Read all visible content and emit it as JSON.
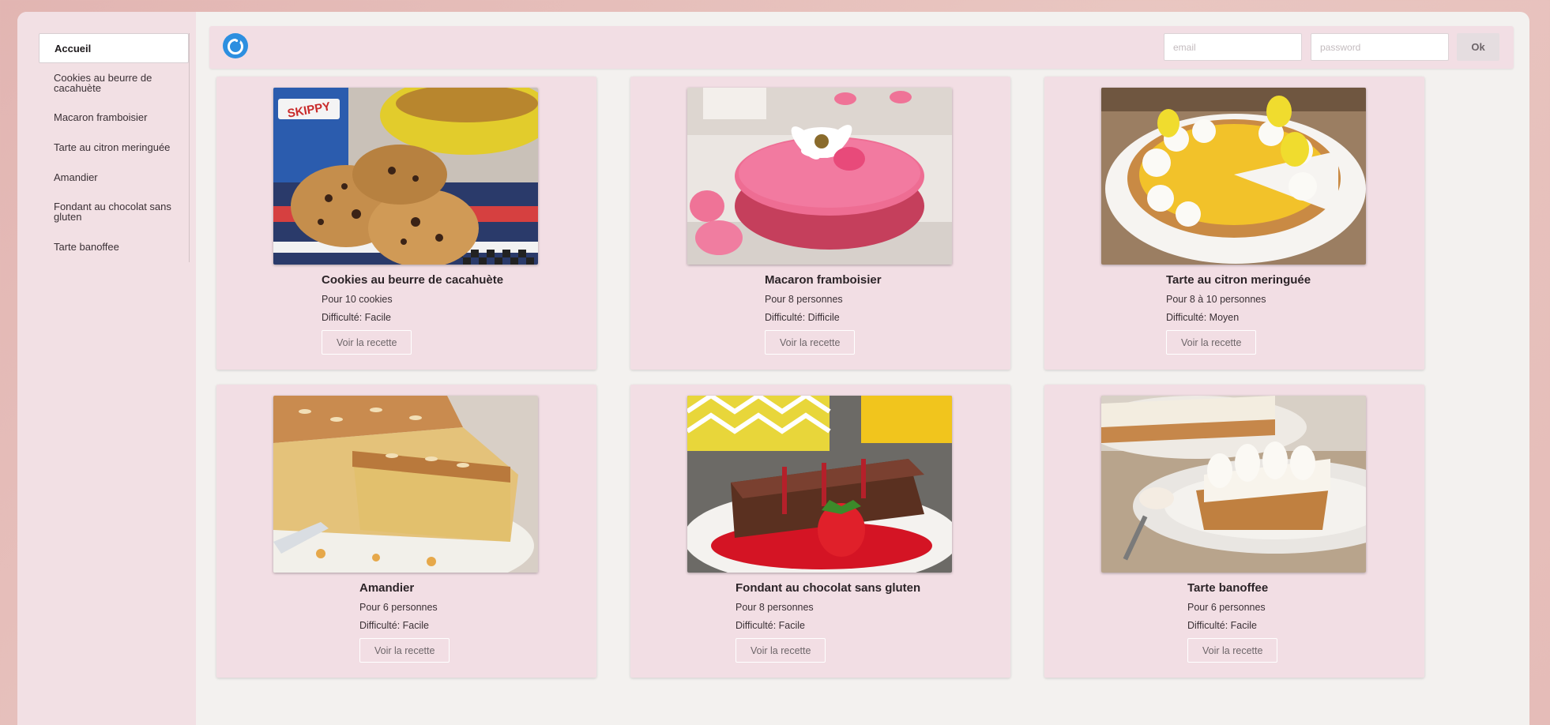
{
  "sidebar": {
    "items": [
      {
        "label": "Accueil"
      },
      {
        "label": "Cookies au beurre de cacahuète"
      },
      {
        "label": "Macaron framboisier"
      },
      {
        "label": "Tarte au citron meringuée"
      },
      {
        "label": "Amandier"
      },
      {
        "label": "Fondant au chocolat sans gluten"
      },
      {
        "label": "Tarte banoffee"
      }
    ]
  },
  "header": {
    "email_placeholder": "email",
    "password_placeholder": "password",
    "ok_label": "Ok"
  },
  "cards": [
    {
      "title": "Cookies au beurre de cacahuète",
      "servings": "Pour 10 cookies",
      "difficulty": "Difficulté: Facile",
      "button": "Voir la recette",
      "image": "cookies-photo",
      "image_text": "SKIPPY"
    },
    {
      "title": "Macaron framboisier",
      "servings": "Pour 8 personnes",
      "difficulty": "Difficulté: Difficile",
      "button": "Voir la recette",
      "image": "macaron-photo"
    },
    {
      "title": "Tarte au citron meringuée",
      "servings": "Pour 8 à 10 personnes",
      "difficulty": "Difficulté: Moyen",
      "button": "Voir la recette",
      "image": "lemon-tart-photo"
    },
    {
      "title": "Amandier",
      "servings": "Pour 6 personnes",
      "difficulty": "Difficulté: Facile",
      "button": "Voir la recette",
      "image": "almond-cake-photo"
    },
    {
      "title": "Fondant au chocolat sans gluten",
      "servings": "Pour 8 personnes",
      "difficulty": "Difficulté: Facile",
      "button": "Voir la recette",
      "image": "chocolate-cake-photo"
    },
    {
      "title": "Tarte banoffee",
      "servings": "Pour 6 personnes",
      "difficulty": "Difficulté: Facile",
      "button": "Voir la recette",
      "image": "banoffee-photo"
    }
  ],
  "colors": {
    "background": "#e5bcb8",
    "panel": "#f2dee4",
    "content": "#f3f1ef",
    "logo": "#2d8fe0"
  }
}
